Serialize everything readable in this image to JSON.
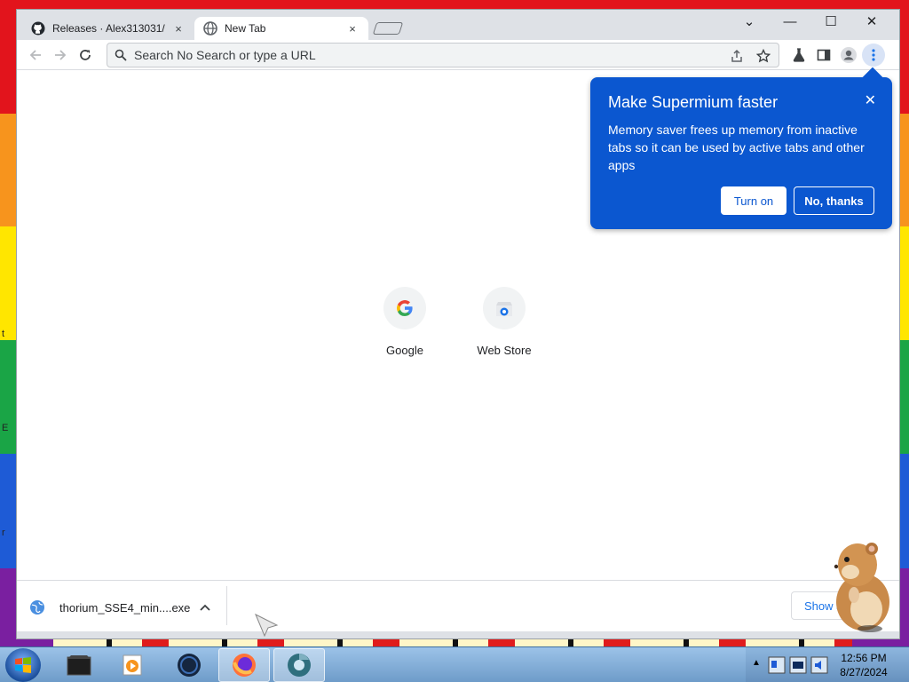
{
  "desktop": {
    "edge_text": [
      "t",
      "E",
      "r"
    ]
  },
  "tabs": [
    {
      "title": "Releases · Alex313031/",
      "close": "×",
      "icon": "github-icon"
    },
    {
      "title": "New Tab",
      "close": "×",
      "icon": "globe-icon"
    }
  ],
  "window_controls": {
    "tab_search": "⌄",
    "minimize": "—",
    "maximize": "☐",
    "close": "✕"
  },
  "omnibox": {
    "placeholder": "Search No Search or type a URL",
    "value": ""
  },
  "shortcuts": [
    {
      "label": "Google",
      "icon": "google-g-icon"
    },
    {
      "label": "Web Store",
      "icon": "web-store-icon"
    }
  ],
  "promo": {
    "title": "Make Supermium faster",
    "body": "Memory saver frees up memory from inactive tabs so it can be used by active tabs and other apps",
    "close": "✕",
    "turn_on": "Turn on",
    "no_thanks": "No, thanks"
  },
  "download": {
    "filename": "thorium_SSE4_min....exe",
    "show_all": "Show all"
  },
  "taskbar": {
    "time": "12:56 PM",
    "date": "8/27/2024"
  },
  "colors": {
    "promo_bg": "#0b57d0",
    "accent": "#1a73e8"
  }
}
